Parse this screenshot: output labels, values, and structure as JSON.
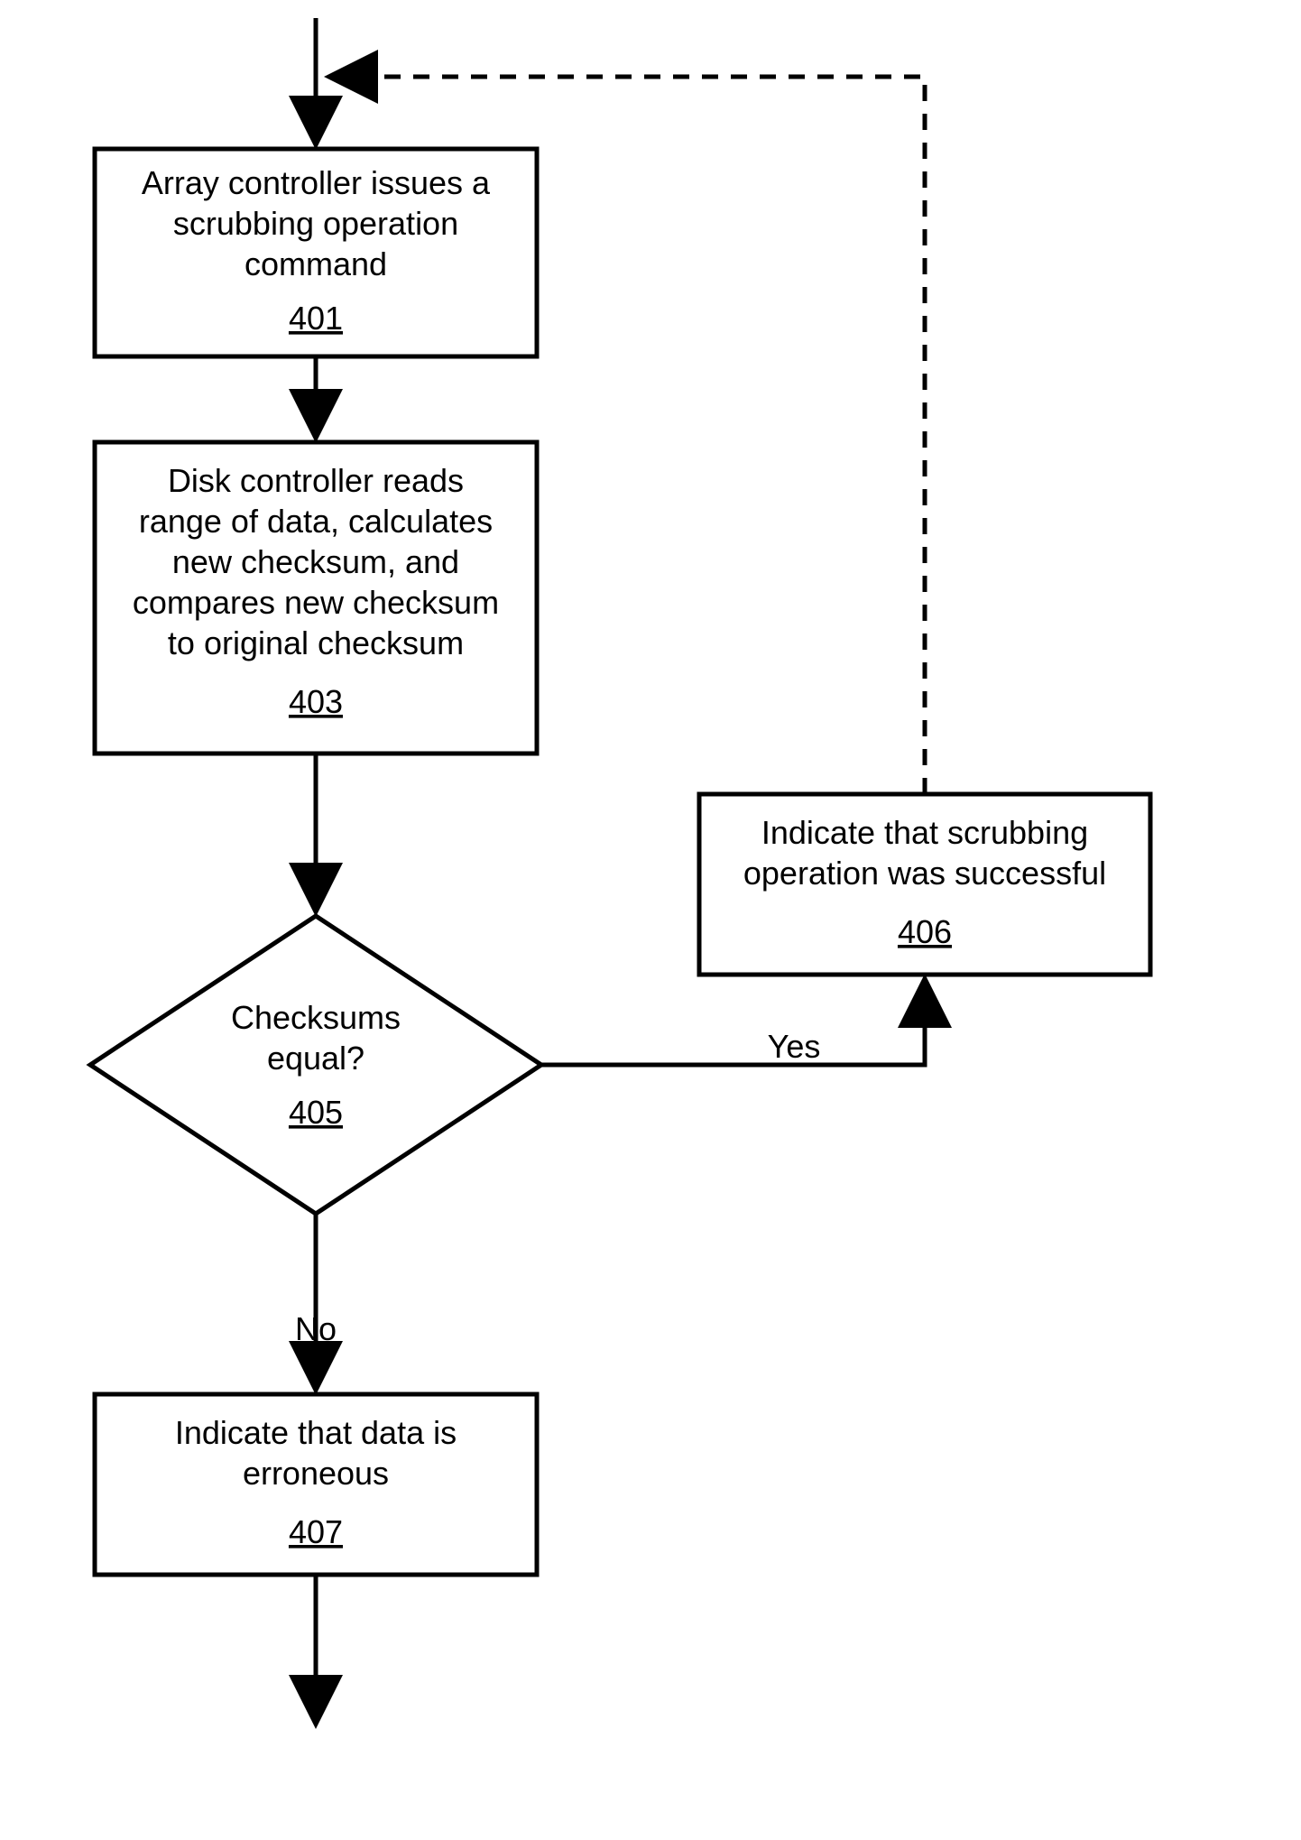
{
  "flow": {
    "box401": {
      "line1": "Array controller issues a",
      "line2": "scrubbing operation",
      "line3": "command",
      "ref": "401"
    },
    "box403": {
      "line1": "Disk controller reads",
      "line2": "range of data, calculates",
      "line3": "new checksum, and",
      "line4": "compares new checksum",
      "line5": "to original checksum",
      "ref": "403"
    },
    "dec405": {
      "line1": "Checksums",
      "line2": "equal?",
      "ref": "405"
    },
    "box406": {
      "line1": "Indicate that scrubbing",
      "line2": "operation was successful",
      "ref": "406"
    },
    "box407": {
      "line1": "Indicate that data is",
      "line2": "erroneous",
      "ref": "407"
    },
    "labels": {
      "yes": "Yes",
      "no": "No"
    }
  }
}
